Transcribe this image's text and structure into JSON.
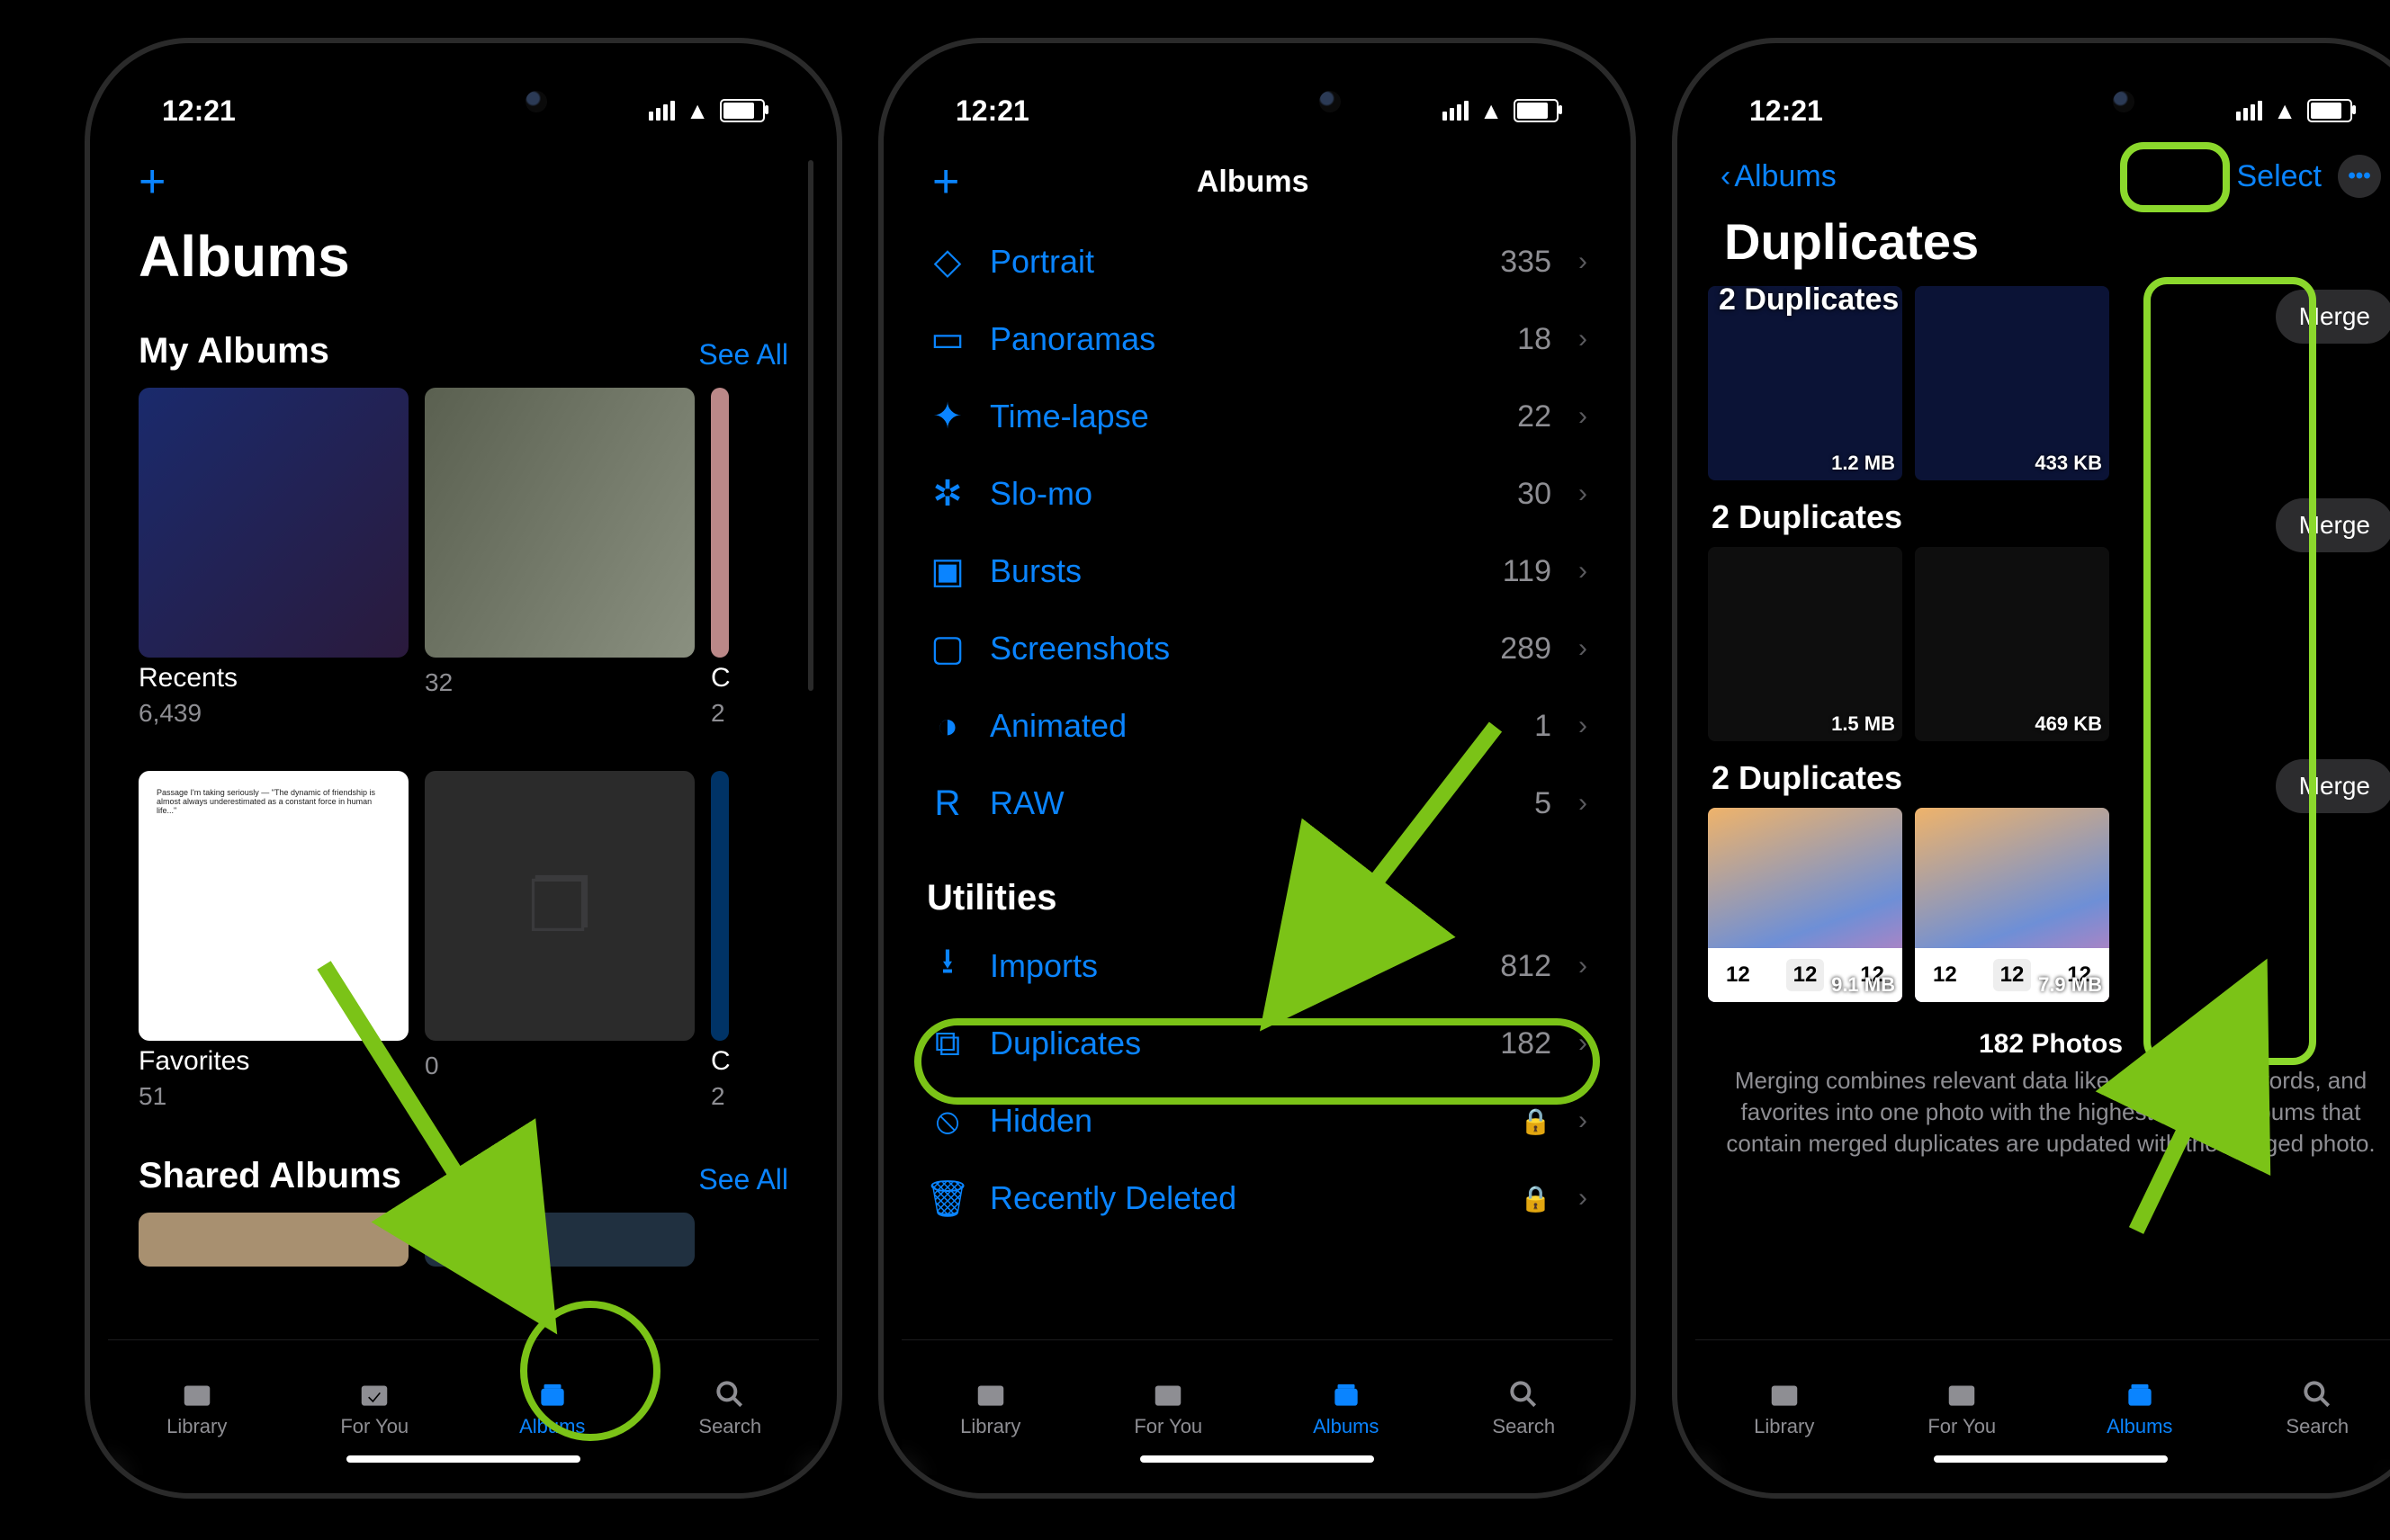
{
  "status": {
    "time": "12:21"
  },
  "tabs": {
    "library": "Library",
    "foryou": "For You",
    "albums": "Albums",
    "search": "Search"
  },
  "phone1": {
    "add_label": "+",
    "title": "Albums",
    "my_albums": "My Albums",
    "see_all": "See All",
    "albums": [
      {
        "name": "Recents",
        "count": "6,439"
      },
      {
        "name": "",
        "count": "32"
      },
      {
        "name": "C",
        "count": "2"
      }
    ],
    "albums2": [
      {
        "name": "Favorites",
        "count": "51"
      },
      {
        "name": "",
        "count": "0"
      },
      {
        "name": "C",
        "count": "2"
      }
    ],
    "shared": "Shared Albums"
  },
  "phone2": {
    "title": "Albums",
    "media_types": [
      {
        "name": "Portrait",
        "count": "335"
      },
      {
        "name": "Panoramas",
        "count": "18"
      },
      {
        "name": "Time-lapse",
        "count": "22"
      },
      {
        "name": "Slo-mo",
        "count": "30"
      },
      {
        "name": "Bursts",
        "count": "119"
      },
      {
        "name": "Screenshots",
        "count": "289"
      },
      {
        "name": "Animated",
        "count": "1"
      },
      {
        "name": "RAW",
        "count": "5"
      }
    ],
    "utilities_header": "Utilities",
    "utilities": [
      {
        "name": "Imports",
        "count": "812",
        "lock": false
      },
      {
        "name": "Duplicates",
        "count": "182",
        "lock": false
      },
      {
        "name": "Hidden",
        "count": "",
        "lock": true
      },
      {
        "name": "Recently Deleted",
        "count": "",
        "lock": true
      }
    ]
  },
  "phone3": {
    "back": "Albums",
    "select": "Select",
    "title": "Duplicates",
    "groups": [
      {
        "label": "2 Duplicates",
        "sizes": [
          "1.2 MB",
          "433 KB"
        ]
      },
      {
        "label": "2 Duplicates",
        "sizes": [
          "1.5 MB",
          "469 KB"
        ]
      },
      {
        "label": "2 Duplicates",
        "sizes": [
          "9.1 MB",
          "7.9 MB"
        ]
      }
    ],
    "merge": "Merge",
    "footer_count": "182 Photos",
    "footer_desc": "Merging combines relevant data like captions, keywords, and favorites into one photo with the highest quality. Albums that contain merged duplicates are updated with the merged photo.",
    "thumb_day": "12"
  }
}
